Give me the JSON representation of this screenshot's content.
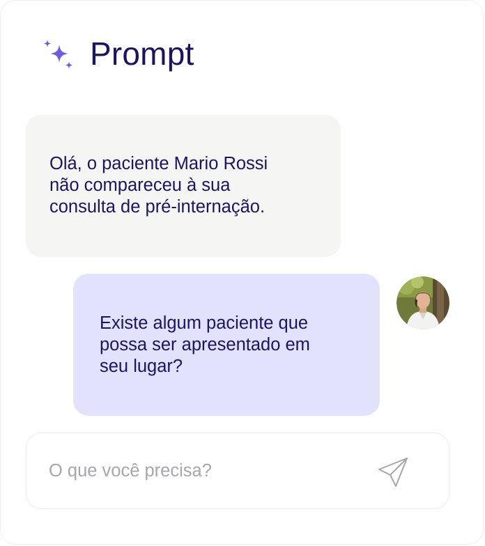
{
  "header": {
    "icon": "sparkles-icon",
    "title": "Prompt",
    "accent_color": "#6b5ce7"
  },
  "messages": [
    {
      "role": "assistant",
      "lines": [
        "Olá, o paciente Mario Rossi",
        "não compareceu à sua",
        "consulta de pré-internação."
      ],
      "background": "#f5f5f3"
    },
    {
      "role": "user",
      "lines": [
        "Existe algum paciente que",
        "possa ser apresentado em",
        "seu lugar?"
      ],
      "background": "#e3e2fd",
      "avatar": "user-avatar"
    }
  ],
  "composer": {
    "placeholder": "O que você precisa?",
    "value": "",
    "send_icon": "paper-plane-icon"
  },
  "colors": {
    "text": "#1b1464",
    "placeholder": "#a6a6ac",
    "border": "#ececee"
  }
}
